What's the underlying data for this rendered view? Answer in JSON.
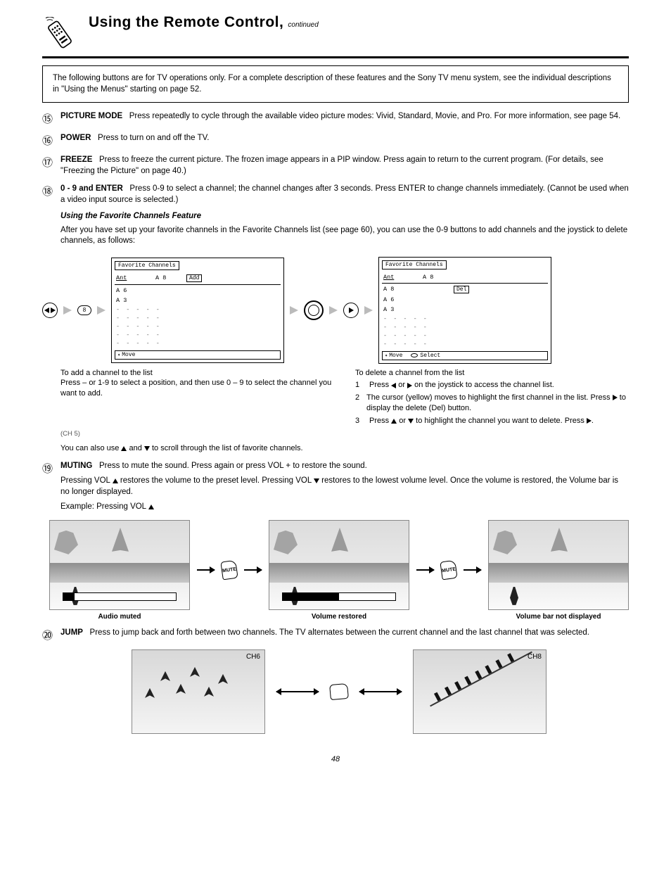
{
  "header": {
    "title": "Using the Remote Control,",
    "continued": "continued"
  },
  "intro": "The following buttons are for TV operations only. For a complete description of these features and the Sony TV menu system, see the individual descriptions in \"Using the Menus\" starting on page 52.",
  "items": {
    "n15": {
      "num": "⑮",
      "label": "PICTURE MODE",
      "text": "Press repeatedly to cycle through the available video picture modes: Vivid, Standard, Movie, and Pro. For more information, see page 54."
    },
    "n16": {
      "num": "⑯",
      "label": "POWER",
      "text": "Press to turn on and off the TV."
    },
    "n17": {
      "num": "⑰",
      "label": "FREEZE",
      "text": "Press to freeze the current picture. The frozen image appears in a PIP window. Press again to return to the current program. (For details, see \"Freezing the Picture\" on page 40.)"
    },
    "n18": {
      "num": "⑱",
      "label": "0 - 9 and ENTER",
      "text": "Press 0-9 to select a channel; the channel changes after 3 seconds. Press ENTER to change channels immediately. (Cannot be used when a video input source is selected.)",
      "sub_label": "Using the Favorite Channels Feature",
      "sub_text": "After you have set up your favorite channels in the Favorite Channels list (see page 60), you can use the 0-9 buttons to add channels and the joystick to delete channels, as follows:",
      "add_heading": "To add a channel to the list",
      "add_body": "Press – or 1-9 to select a position, and then use 0 – 9 to select the channel you want to add.",
      "del_heading": "To delete a channel from the list",
      "del_steps": [
        "Press ◀ or ▶ on the joystick to access the channel list.",
        "The cursor (yellow) moves to highlight the first channel in the list. Press ▶ to display the delete (Del) button.",
        "Press ▲ or ▼ to highlight the channel you want to delete. Press ▶.",
        "You can also use ▲ and ▼ to scroll through the list of favorite channels."
      ]
    },
    "n19": {
      "num": "⑲",
      "label": "MUTING",
      "text": "Press to mute the sound. Press again or press VOL + to restore the sound.",
      "hint": "Pressing VOL ▲ restores the volume to the preset level. Pressing VOL ▼ restores to the lowest volume level. Once the volume is restored, the Volume bar is no longer displayed.",
      "example": "Example: Pressing VOL ▲",
      "captions": [
        "Audio muted",
        "Volume restored",
        "Volume bar not displayed"
      ]
    },
    "n20": {
      "num": "⑳",
      "label": "JUMP",
      "text": "Press to jump back and forth between two channels. The TV alternates between the current channel and the last channel that was selected."
    },
    "channel_note": "(CH 5)"
  },
  "menu1": {
    "title": "Favorite Channels",
    "rows": [
      {
        "c1": "Ant",
        "c2": "A 8",
        "btn": "Add"
      },
      {
        "c1": "A 6",
        "c2": "",
        "btn": ""
      },
      {
        "c1": "A 3",
        "c2": "",
        "btn": ""
      }
    ],
    "dashes": [
      "- - - - -",
      "- - - - -",
      "- - - - -",
      "- - - - -",
      "- - - - -"
    ],
    "footer_move": "Move"
  },
  "menu2": {
    "title": "Favorite Channels",
    "rows": [
      {
        "c1": "Ant",
        "c2": "A 8",
        "btn": ""
      },
      {
        "c1": "A 8",
        "c2": "",
        "btn": "Del"
      },
      {
        "c1": "A 6",
        "c2": "",
        "btn": ""
      },
      {
        "c1": "A 3",
        "c2": "",
        "btn": ""
      }
    ],
    "dashes": [
      "- - - - -",
      "- - - - -",
      "- - - - -",
      "- - - - -"
    ],
    "footer_move": "Move",
    "footer_select": "Select"
  },
  "num_btn": "8",
  "mute": "MUTE",
  "ch_labels": {
    "left": "CH6",
    "right": "CH8"
  },
  "page_number": "48"
}
